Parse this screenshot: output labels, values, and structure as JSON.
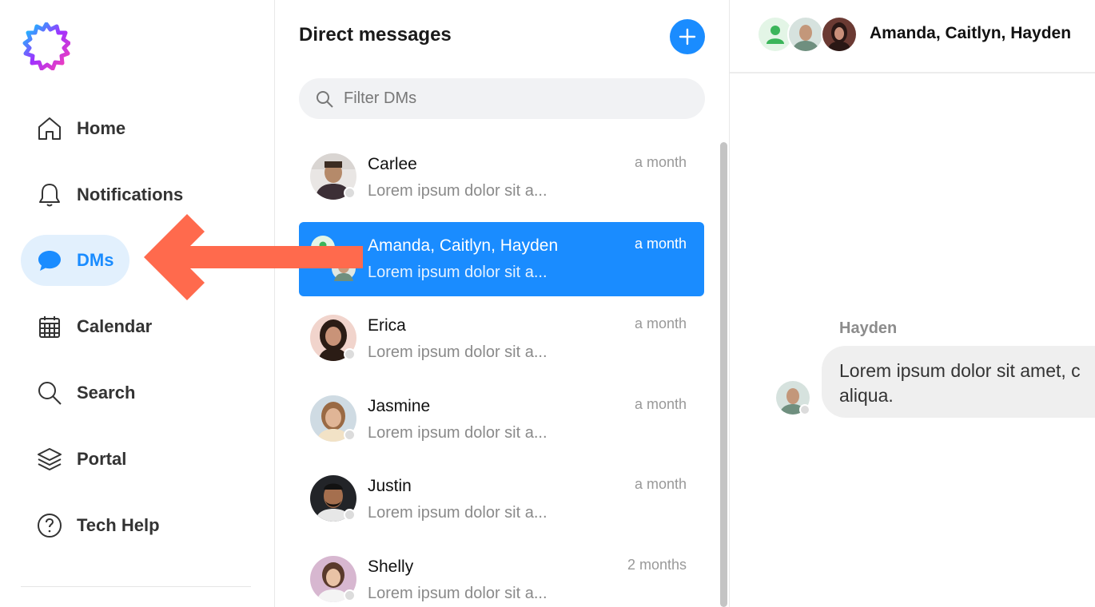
{
  "sidebar": {
    "logo": "sunburst-logo",
    "items": [
      {
        "label": "Home",
        "icon": "home-icon"
      },
      {
        "label": "Notifications",
        "icon": "bell-icon"
      },
      {
        "label": "DMs",
        "icon": "chat-bubble-icon",
        "active": true
      },
      {
        "label": "Calendar",
        "icon": "calendar-icon"
      },
      {
        "label": "Search",
        "icon": "search-icon"
      },
      {
        "label": "Portal",
        "icon": "layers-icon"
      },
      {
        "label": "Tech Help",
        "icon": "help-circle-icon"
      }
    ]
  },
  "dm_pane": {
    "title": "Direct messages",
    "new_button_icon": "plus-icon",
    "filter": {
      "placeholder": "Filter DMs",
      "value": ""
    },
    "conversations": [
      {
        "name": "Carlee",
        "preview": "Lorem ipsum dolor sit a...",
        "time": "a month"
      },
      {
        "name": "Amanda, Caitlyn, Hayden",
        "preview": "Lorem ipsum dolor sit a...",
        "time": "a month",
        "selected": true
      },
      {
        "name": "Erica",
        "preview": "Lorem ipsum dolor sit a...",
        "time": "a month"
      },
      {
        "name": "Jasmine",
        "preview": "Lorem ipsum dolor sit a...",
        "time": "a month"
      },
      {
        "name": "Justin",
        "preview": "Lorem ipsum dolor sit a...",
        "time": "a month"
      },
      {
        "name": "Shelly",
        "preview": "Lorem ipsum dolor sit a...",
        "time": "2 months"
      }
    ]
  },
  "conversation": {
    "title": "Amanda, Caitlyn, Hayden",
    "messages": [
      {
        "sender": "Hayden",
        "text": "Lorem ipsum dolor sit amet, c\naliqua."
      }
    ]
  },
  "colors": {
    "accent": "#1a8cff",
    "active_nav_bg": "#e2f0fd",
    "arrow": "#ff6a4d"
  }
}
